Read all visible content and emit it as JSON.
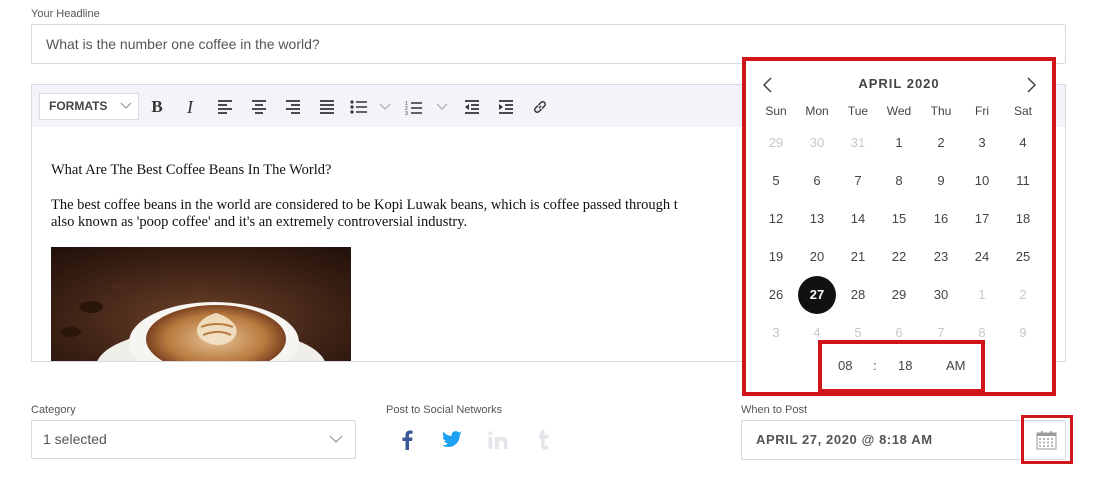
{
  "headline": {
    "label": "Your Headline",
    "placeholder": "What is the number one coffee in the world?"
  },
  "editor": {
    "formats_label": "FORMATS",
    "bold_label": "B",
    "italic_label": "I",
    "heading": "What Are The Best Coffee Beans In The World?",
    "paragraph_line1": "The best coffee beans in the world are considered to be Kopi Luwak beans, which is coffee passed through t",
    "paragraph_line2": "also known as 'poop coffee' and it's an extremely controversial industry.",
    "image_desc": "coffee-latte-art-image"
  },
  "category": {
    "label": "Category",
    "value": "1 selected"
  },
  "social": {
    "label": "Post to Social Networks",
    "networks": [
      {
        "name": "facebook-icon",
        "active": true,
        "color": "#3b5998"
      },
      {
        "name": "twitter-icon",
        "active": true,
        "color": "#1da1f2"
      },
      {
        "name": "linkedin-icon",
        "active": false,
        "color": "#e2e5ea"
      },
      {
        "name": "tumblr-icon",
        "active": false,
        "color": "#e2e5ea"
      }
    ]
  },
  "schedule": {
    "label": "When to Post",
    "value": "APRIL 27, 2020 @ 8:18 AM"
  },
  "calendar": {
    "month_label": "APRIL 2020",
    "weekdays": [
      "Sun",
      "Mon",
      "Tue",
      "Wed",
      "Thu",
      "Fri",
      "Sat"
    ],
    "weeks": [
      [
        {
          "d": "29",
          "m": true
        },
        {
          "d": "30",
          "m": true
        },
        {
          "d": "31",
          "m": true
        },
        {
          "d": "1"
        },
        {
          "d": "2"
        },
        {
          "d": "3"
        },
        {
          "d": "4"
        }
      ],
      [
        {
          "d": "5"
        },
        {
          "d": "6"
        },
        {
          "d": "7"
        },
        {
          "d": "8"
        },
        {
          "d": "9"
        },
        {
          "d": "10"
        },
        {
          "d": "11"
        }
      ],
      [
        {
          "d": "12"
        },
        {
          "d": "13"
        },
        {
          "d": "14"
        },
        {
          "d": "15"
        },
        {
          "d": "16"
        },
        {
          "d": "17"
        },
        {
          "d": "18"
        }
      ],
      [
        {
          "d": "19"
        },
        {
          "d": "20"
        },
        {
          "d": "21"
        },
        {
          "d": "22"
        },
        {
          "d": "23"
        },
        {
          "d": "24"
        },
        {
          "d": "25"
        }
      ],
      [
        {
          "d": "26"
        },
        {
          "d": "27",
          "sel": true
        },
        {
          "d": "28"
        },
        {
          "d": "29"
        },
        {
          "d": "30"
        },
        {
          "d": "1",
          "m": true
        },
        {
          "d": "2",
          "m": true
        }
      ],
      [
        {
          "d": "3",
          "m": true
        },
        {
          "d": "4",
          "m": true
        },
        {
          "d": "5",
          "m": true
        },
        {
          "d": "6",
          "m": true
        },
        {
          "d": "7",
          "m": true
        },
        {
          "d": "8",
          "m": true
        },
        {
          "d": "9",
          "m": true
        }
      ]
    ],
    "time": {
      "hour": "08",
      "separator": ":",
      "minute": "18",
      "ampm": "AM"
    }
  },
  "colors": {
    "highlight": "#d0161b",
    "selected_day": "#111111",
    "facebook": "#3b5998",
    "twitter": "#1da1f2"
  }
}
